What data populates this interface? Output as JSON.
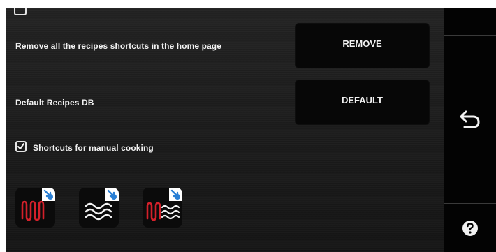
{
  "settings": {
    "remove_shortcuts": {
      "label": "Remove all the recipes shortcuts in the home page",
      "button": "REMOVE"
    },
    "default_db": {
      "label": "Default Recipes DB",
      "button": "DEFAULT"
    },
    "manual_shortcuts": {
      "label": "Shortcuts for manual cooking",
      "checked": true
    }
  },
  "shortcuts": [
    {
      "icon": "grill-heat-shortcut-icon"
    },
    {
      "icon": "steam-shortcut-icon"
    },
    {
      "icon": "combi-heat-steam-shortcut-icon"
    }
  ],
  "sidebar": {
    "back_icon": "back-arrow-icon",
    "help_icon": "help-icon"
  },
  "colors": {
    "heat": "#d4202a",
    "badge": "#2a7fd4",
    "button_bg": "#070707",
    "text": "#f2f2f2"
  }
}
